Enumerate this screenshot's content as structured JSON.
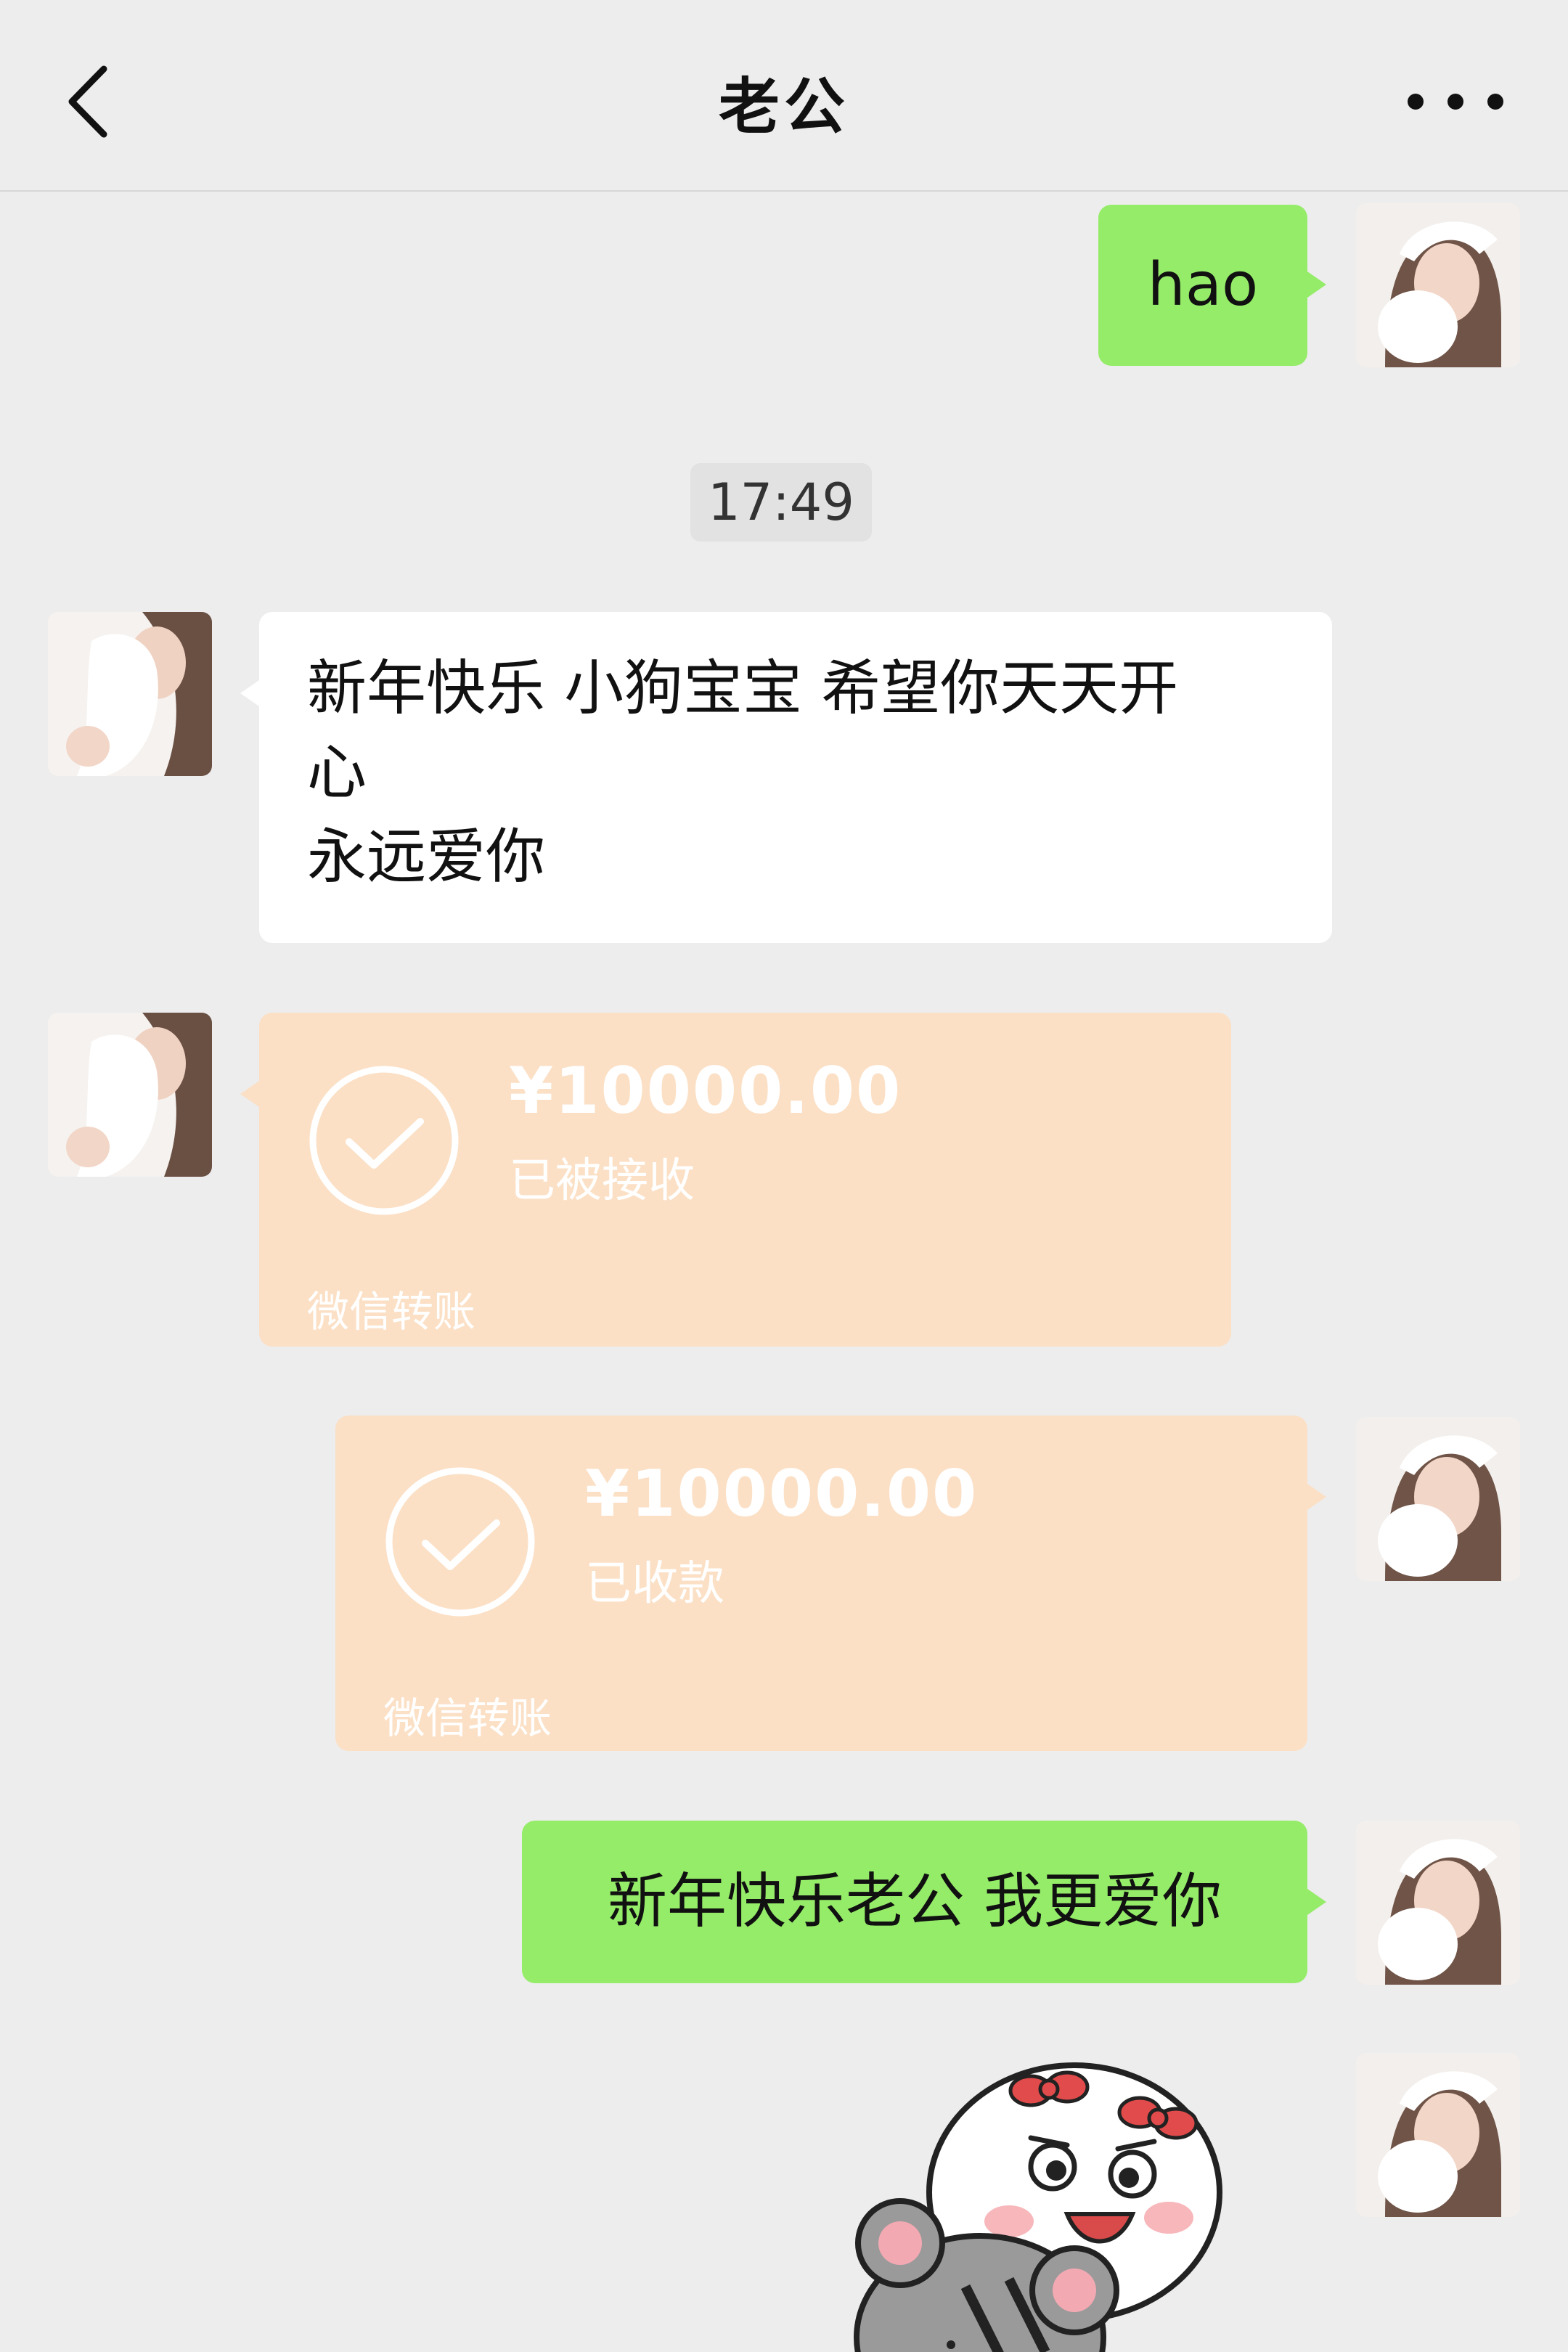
{
  "header": {
    "title": "老公",
    "back_icon": "chevron-left-icon",
    "more_icon": "more-dots-icon"
  },
  "messages": [
    {
      "id": "m1",
      "side": "right",
      "type": "text",
      "text": "hao"
    },
    {
      "id": "t1",
      "type": "timestamp",
      "text": "17:49"
    },
    {
      "id": "m2",
      "side": "left",
      "type": "text",
      "lines": [
        "新年快乐 小狗宝宝 希望你天天开",
        "心",
        "永远爱你"
      ]
    },
    {
      "id": "m3",
      "side": "left",
      "type": "transfer",
      "amount": "¥10000.00",
      "status": "已被接收",
      "footer": "微信转账"
    },
    {
      "id": "m4",
      "side": "right",
      "type": "transfer",
      "amount": "¥10000.00",
      "status": "已收款",
      "footer": "微信转账"
    },
    {
      "id": "m5",
      "side": "right",
      "type": "text",
      "text": "新年快乐老公 我更爱你"
    },
    {
      "id": "m6",
      "side": "right",
      "type": "sticker",
      "sticker": "bunny-and-mouse-sticker"
    }
  ],
  "colors": {
    "background": "#ededed",
    "self_bubble": "#95ec69",
    "other_bubble": "#ffffff",
    "transfer_bubble": "#fbe0c6"
  }
}
